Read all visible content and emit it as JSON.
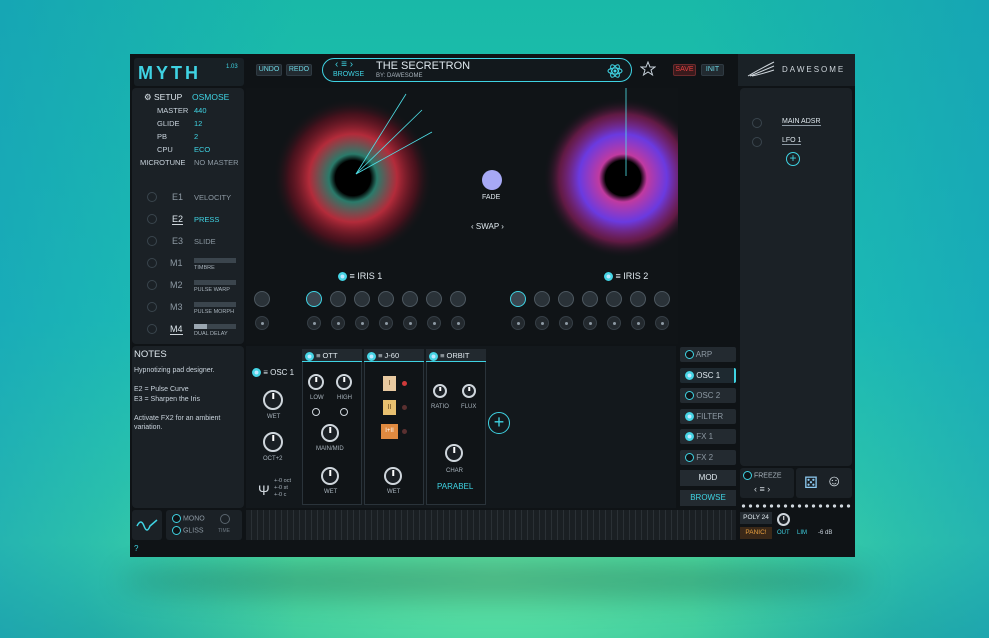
{
  "app": {
    "logo": "MYTH",
    "version": "1.03",
    "brand": "DAWESOME"
  },
  "toolbar": {
    "undo": "UNDO",
    "redo": "REDO",
    "browse": "BROWSE",
    "preset_name": "THE SECRETRON",
    "preset_author": "BY: DAWESOME",
    "save": "SAVE",
    "init": "INIT"
  },
  "setup": {
    "title": "SETUP",
    "mode": "OSMOSE",
    "rows": [
      {
        "label": "MASTER",
        "value": "440"
      },
      {
        "label": "GLIDE",
        "value": "12"
      },
      {
        "label": "PB",
        "value": "2"
      },
      {
        "label": "CPU",
        "value": "ECO"
      },
      {
        "label": "MICROTUNE",
        "value": "NO MASTER"
      }
    ]
  },
  "expr": [
    {
      "id": "E1",
      "label": "VELOCITY"
    },
    {
      "id": "E2",
      "label": "PRESS"
    },
    {
      "id": "E3",
      "label": "SLIDE"
    }
  ],
  "macros": [
    {
      "id": "M1",
      "label": "TIMBRE",
      "level": 0
    },
    {
      "id": "M2",
      "label": "PULSE WARP",
      "level": 0
    },
    {
      "id": "M3",
      "label": "PULSE MORPH",
      "level": 0
    },
    {
      "id": "M4",
      "label": "DUAL DELAY",
      "level": 0.3
    }
  ],
  "center": {
    "fade": "FADE",
    "swap": "SWAP",
    "iris1": "IRIS 1",
    "iris2": "IRIS 2"
  },
  "mod": {
    "main_adsr": "MAIN ADSR",
    "lfo1": "LFO 1"
  },
  "notes": {
    "title": "NOTES",
    "lines": [
      "Hypnotizing pad designer.",
      "",
      "E2 = Pulse Curve",
      "E3 = Sharpen the Iris",
      "",
      "Activate FX2 for an ambient variation."
    ]
  },
  "osc": {
    "title": "OSC 1",
    "wet": "WET",
    "oct": "OCT+2",
    "tune": [
      "+-0 oct",
      "+-0 st",
      "+-0 c"
    ]
  },
  "fx": [
    {
      "name": "OTT",
      "knobs": [
        "LOW",
        "HIGH",
        "MAIN/MID",
        "WET"
      ]
    },
    {
      "name": "J-60",
      "buttons": [
        "I",
        "II",
        "I+II"
      ],
      "knobs": [
        "WET"
      ]
    },
    {
      "name": "ORBIT",
      "knobs": [
        "RATIO",
        "FLUX",
        "CHAR"
      ],
      "mode": "PARABEL"
    }
  ],
  "tabs": [
    "ARP",
    "OSC 1",
    "OSC 2",
    "FILTER",
    "FX 1",
    "FX 2"
  ],
  "side_buttons": {
    "mod": "MOD",
    "browse": "BROWSE"
  },
  "bottom": {
    "mono": "MONO",
    "gliss": "GLISS",
    "time": "TIME",
    "freeze": "FREEZE",
    "poly": "POLY 24",
    "panic": "PANIC!",
    "out": "OUT",
    "lim": "LIM",
    "db": "-6 dB",
    "help": "?"
  },
  "colors": {
    "accent": "#3fd3e3",
    "save": "#e04040"
  }
}
